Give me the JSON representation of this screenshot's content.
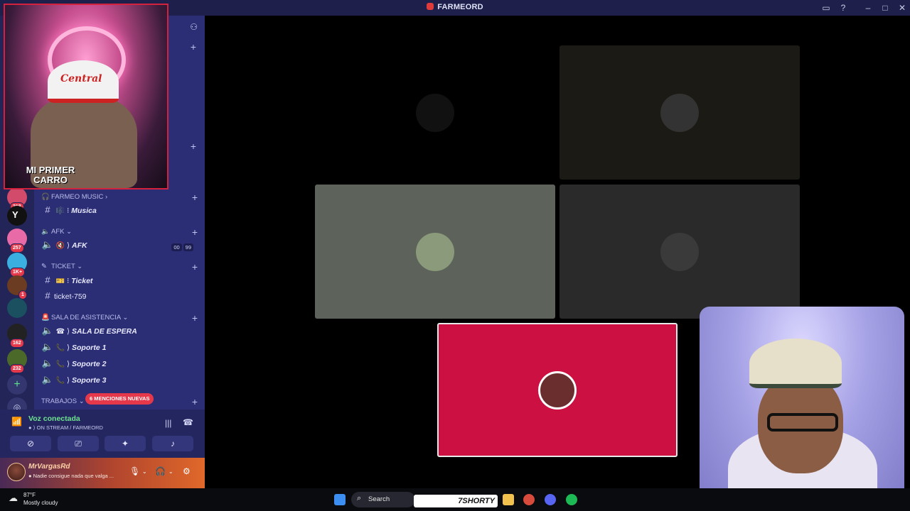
{
  "window": {
    "title": "FARMEORD"
  },
  "servers": [
    {
      "badge": "218",
      "color": "#d34b6a"
    },
    {
      "badge": "",
      "color": "#111111"
    },
    {
      "badge": "257",
      "color": "#e86aa6"
    },
    {
      "badge": "1K+",
      "color": "#3bb0e0"
    },
    {
      "badge": "1",
      "color": "#6b3b22"
    },
    {
      "badge": "",
      "color": "#1a5060"
    },
    {
      "badge": "162",
      "color": "#222222"
    },
    {
      "badge": "232",
      "color": "#4b6a2a"
    }
  ],
  "categories": {
    "farmeo_music": "FARMEO MUSIC",
    "afk": "AFK",
    "ticket": "TICKET",
    "sala_asistencia": "SALA DE ASISTENCIA",
    "trabajos": "TRABAJOS"
  },
  "channels": {
    "musica": "Musica",
    "afk": "AFK",
    "afk_users_a": "00",
    "afk_users_b": "99",
    "ticket": "Ticket",
    "ticket_759": "ticket-759",
    "sala_espera": "SALA DE ESPERA",
    "soporte1": "Soporte 1",
    "soporte2": "Soporte 2",
    "soporte3": "Soporte 3"
  },
  "mentions_badge": "6 MENCIONES NUEVAS",
  "voice": {
    "status": "Voz conectada",
    "channel": "ON STREAM / FARMEORD"
  },
  "user": {
    "name": "MrVargasRd",
    "status": "Nadie consigue nada que valga ..."
  },
  "stream_overlay": {
    "line1": "MI PRIMER",
    "line2": "CARRO",
    "cap": "Central"
  },
  "tiles": [
    {
      "bg": "#000000",
      "avatar": "#111111"
    },
    {
      "bg": "#1c1a14",
      "avatar": "#333333"
    },
    {
      "bg": "#5d625b",
      "avatar": "#8a9a7a"
    },
    {
      "bg": "#2a2a2a",
      "avatar": "#3a3a3a"
    },
    {
      "bg": "#cc1041",
      "avatar": "#6b2e2e"
    }
  ],
  "taskbar": {
    "temp": "87°F",
    "weather": "Mostly cloudy",
    "search": "Search",
    "overlay_text": "7SHORTY"
  },
  "colors": {
    "sidebar": "#2b2d75",
    "rail": "#232558",
    "accent_green": "#6de38f",
    "badge_red": "#e5394b"
  }
}
